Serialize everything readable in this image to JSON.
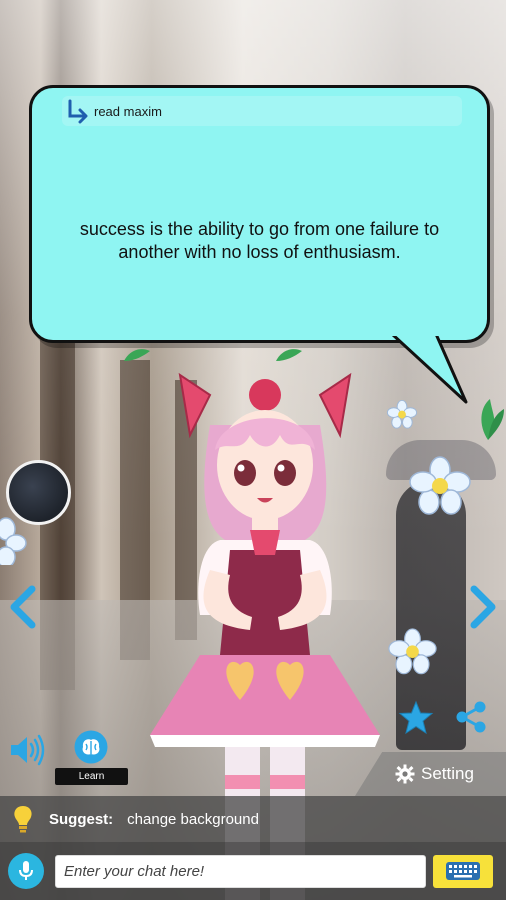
{
  "bubble": {
    "header_label": "read maxim",
    "maxim_text": "success is the ability to go from one failure to another with no loss of enthusiasm."
  },
  "learn": {
    "label": "Learn"
  },
  "setting": {
    "label": "Setting"
  },
  "suggest": {
    "key": "Suggest:",
    "value": "change background"
  },
  "chat": {
    "placeholder": "Enter your chat here!"
  },
  "icons": {
    "reply_arrow": "reply-arrow-icon",
    "speaker": "speaker-icon",
    "brain": "brain-icon",
    "star": "star-icon",
    "share": "share-icon",
    "gear": "gear-icon",
    "bulb": "lightbulb-icon",
    "mic": "microphone-icon",
    "keyboard": "keyboard-icon",
    "prev": "chevron-left-icon",
    "next": "chevron-right-icon"
  },
  "colors": {
    "bubble_bg": "#8ff5f2",
    "accent_blue": "#2bb6e0",
    "keyboard_yellow": "#f7e13a"
  }
}
